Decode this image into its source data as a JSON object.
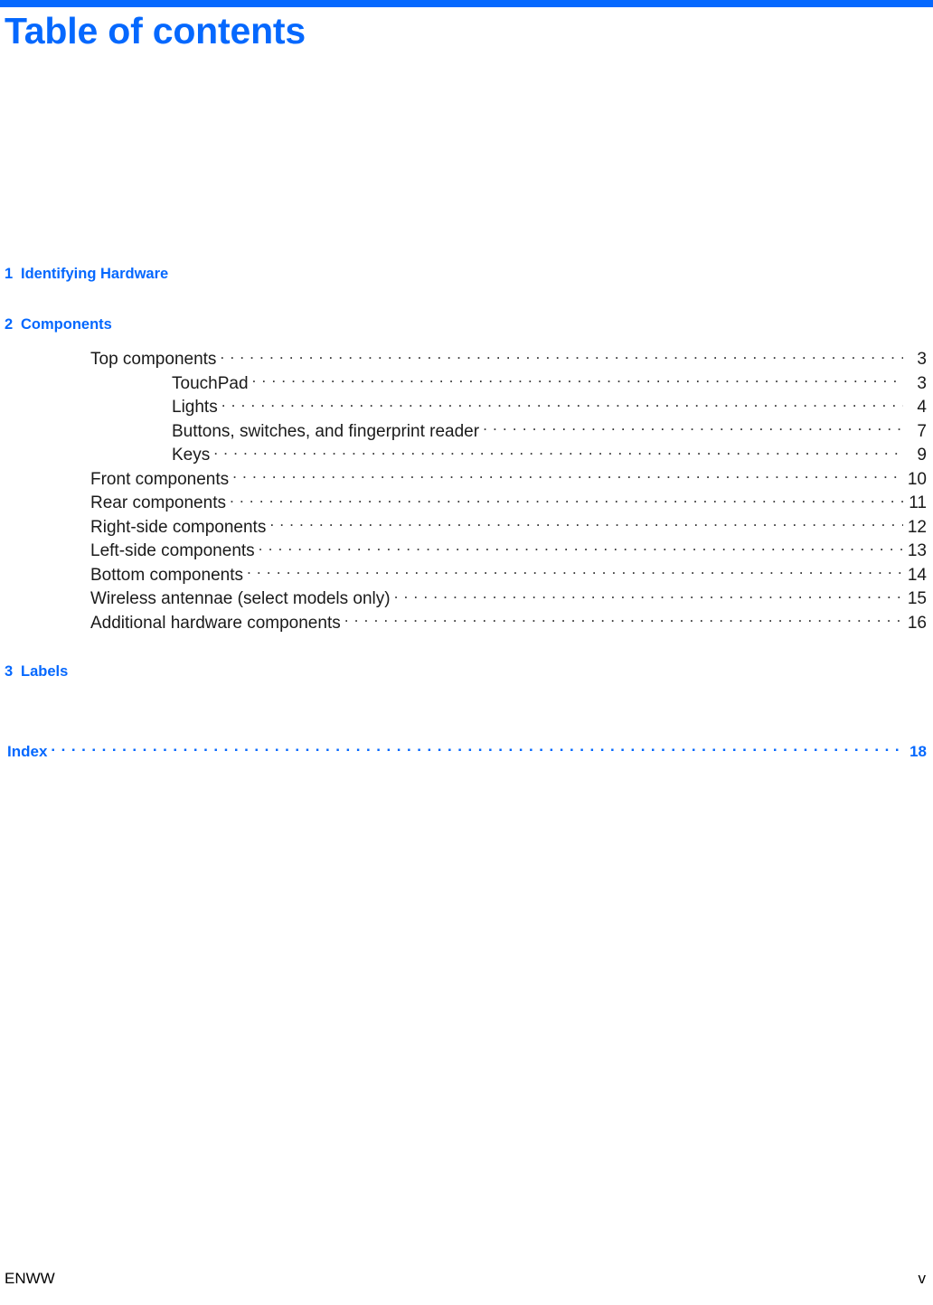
{
  "document": {
    "title": "Table of contents",
    "accent_color": "#0568fe",
    "text_color": "#1a1a1a"
  },
  "toc": {
    "blocks": [
      {
        "chapter": {
          "number": "1",
          "title": "Identifying Hardware"
        },
        "entries": []
      },
      {
        "chapter": {
          "number": "2",
          "title": "Components"
        },
        "entries": [
          {
            "level": 1,
            "label": "Top components",
            "page": "3"
          },
          {
            "level": 2,
            "label": "TouchPad",
            "page": "3"
          },
          {
            "level": 2,
            "label": "Lights",
            "page": "4"
          },
          {
            "level": 2,
            "label": "Buttons, switches, and fingerprint reader",
            "page": "7"
          },
          {
            "level": 2,
            "label": "Keys",
            "page": "9"
          },
          {
            "level": 1,
            "label": "Front components",
            "page": "10"
          },
          {
            "level": 1,
            "label": "Rear components",
            "page": "11"
          },
          {
            "level": 1,
            "label": "Right-side components",
            "page": "12"
          },
          {
            "level": 1,
            "label": "Left-side components",
            "page": "13"
          },
          {
            "level": 1,
            "label": "Bottom components",
            "page": "14"
          },
          {
            "level": 1,
            "label": "Wireless antennae (select models only)",
            "page": "15"
          },
          {
            "level": 1,
            "label": "Additional hardware components",
            "page": "16"
          }
        ]
      },
      {
        "chapter": {
          "number": "3",
          "title": "Labels"
        },
        "entries": []
      }
    ],
    "index": {
      "label": "Index",
      "page": "18"
    }
  },
  "footer": {
    "left": "ENWW",
    "right": "v"
  }
}
